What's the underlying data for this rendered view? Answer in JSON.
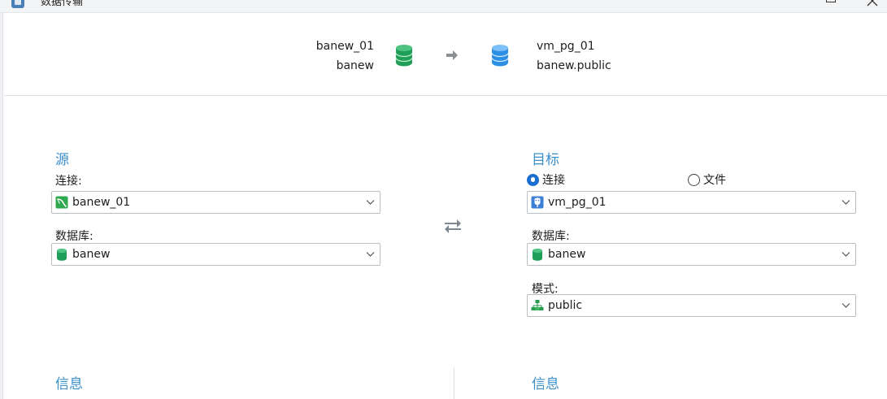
{
  "window": {
    "title": "数据传输"
  },
  "summary": {
    "source": {
      "connection": "banew_01",
      "database": "banew"
    },
    "target": {
      "connection": "vm_pg_01",
      "schema": "banew.public"
    }
  },
  "source": {
    "title": "源",
    "connection_label": "连接:",
    "connection_value": "banew_01",
    "database_label": "数据库:",
    "database_value": "banew"
  },
  "target": {
    "title": "目标",
    "radio_connection": "连接",
    "radio_file": "文件",
    "selected_option": "连接",
    "connection_value": "vm_pg_01",
    "database_label": "数据库:",
    "database_value": "banew",
    "schema_label": "模式:",
    "schema_value": "public"
  },
  "info": {
    "left_title": "信息",
    "right_title": "信息"
  },
  "colors": {
    "accent_blue": "#3a8fcb",
    "source_db_green": "#1e9e57",
    "target_db_blue": "#2b8fe6",
    "radio_selected": "#1a6fd0"
  },
  "icons": {
    "source_db": "database-green-icon",
    "target_db": "database-blue-icon",
    "transfer_arrow": "arrow-right-icon",
    "swap": "swap-arrows-icon",
    "mysql_connection": "mysql-connection-icon",
    "postgres_connection": "postgresql-connection-icon",
    "schema": "schema-tree-icon",
    "chevron": "chevron-down-icon"
  }
}
